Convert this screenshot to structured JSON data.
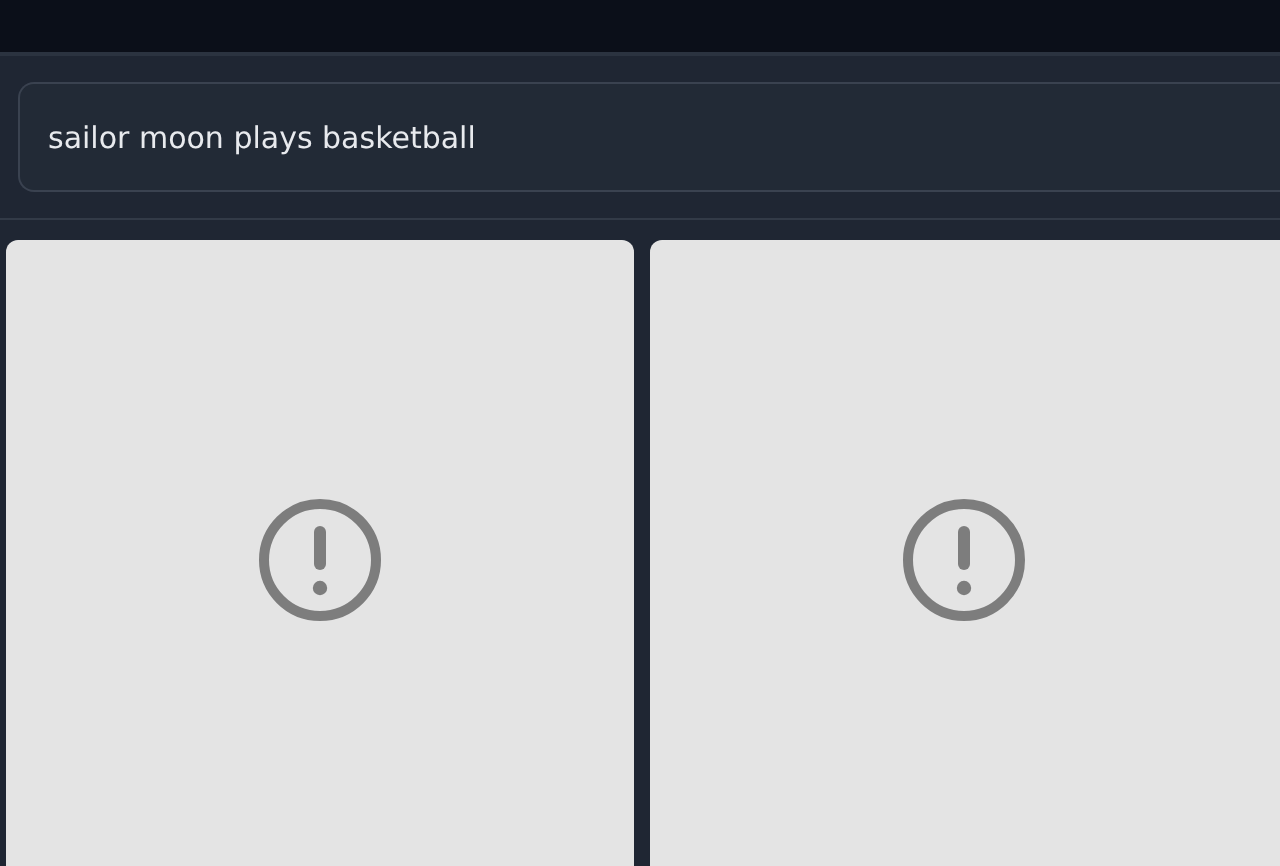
{
  "prompt": {
    "value": "sailor moon plays basketball"
  },
  "results": [
    {
      "kind": "error"
    },
    {
      "kind": "error"
    }
  ]
}
